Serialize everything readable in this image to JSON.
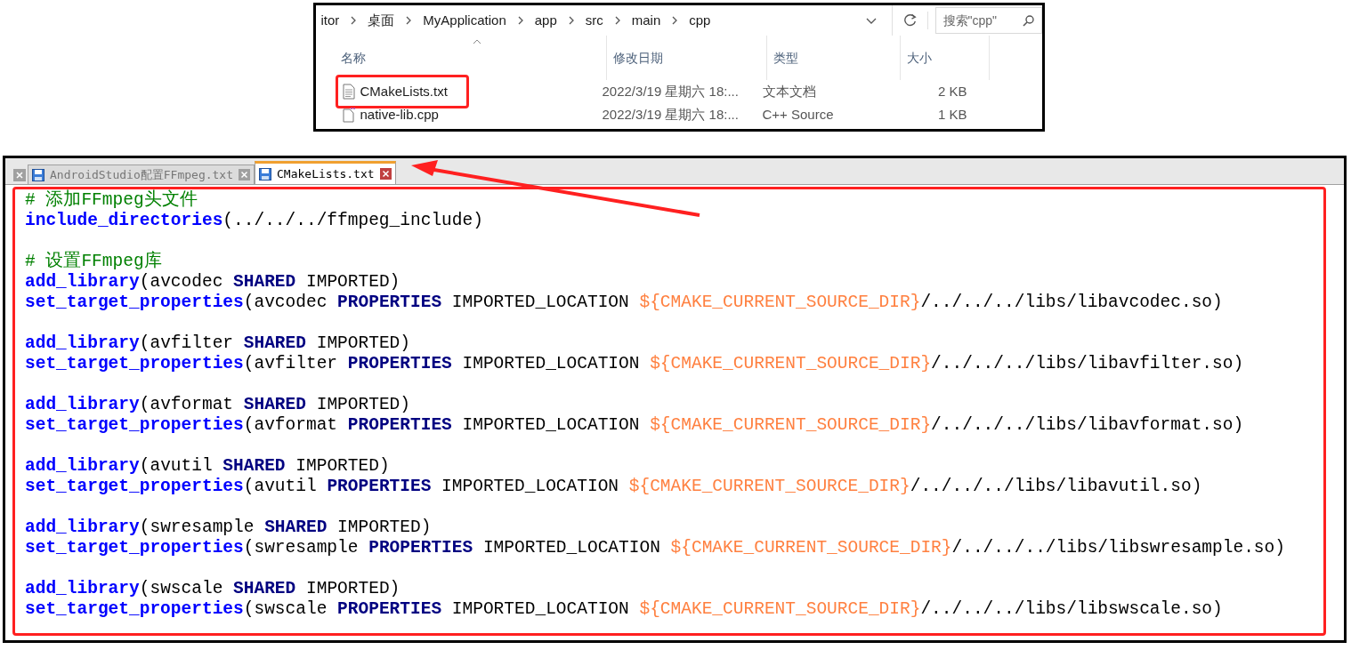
{
  "explorer": {
    "breadcrumb": [
      "itor",
      "桌面",
      "MyApplication",
      "app",
      "src",
      "main",
      "cpp"
    ],
    "search": {
      "placeholder": "搜索\"cpp\""
    },
    "columns": [
      "名称",
      "修改日期",
      "类型",
      "大小"
    ],
    "files": [
      {
        "kind": "text",
        "name": "CMakeLists.txt",
        "modified": "2022/3/19 星期六 18:...",
        "type": "文本文档",
        "size": "2 KB",
        "highlighted": true
      },
      {
        "kind": "source",
        "name": "native-lib.cpp",
        "modified": "2022/3/19 星期六 18:...",
        "type": "C++ Source",
        "size": "1 KB",
        "highlighted": false
      }
    ]
  },
  "editor": {
    "tabs": [
      {
        "label": "AndroidStudio配置FFmpeg.txt",
        "selected": false
      },
      {
        "label": "CMakeLists.txt",
        "selected": true
      }
    ],
    "lines": [
      {
        "tokens": [
          {
            "kind": "comment",
            "text": "# 添加FFmpeg头文件"
          }
        ]
      },
      {
        "tokens": [
          {
            "kind": "func",
            "text": "include_directories"
          },
          {
            "kind": "plain",
            "text": "(../../../ffmpeg_include)"
          }
        ]
      },
      {
        "kind": "blank"
      },
      {
        "tokens": [
          {
            "kind": "comment",
            "text": "# 设置FFmpeg库"
          }
        ]
      },
      {
        "tokens": [
          {
            "kind": "func",
            "text": "add_library"
          },
          {
            "kind": "plain",
            "text": "(avcodec "
          },
          {
            "kind": "keyword",
            "text": "SHARED"
          },
          {
            "kind": "plain",
            "text": " IMPORTED)"
          }
        ]
      },
      {
        "tokens": [
          {
            "kind": "func",
            "text": "set_target_properties"
          },
          {
            "kind": "plain",
            "text": "(avcodec "
          },
          {
            "kind": "keyword",
            "text": "PROPERTIES"
          },
          {
            "kind": "plain",
            "text": " IMPORTED_LOCATION "
          },
          {
            "kind": "var",
            "text": "${CMAKE_CURRENT_SOURCE_DIR}"
          },
          {
            "kind": "plain",
            "text": "/../../../libs/libavcodec.so)"
          }
        ]
      },
      {
        "kind": "blank"
      },
      {
        "tokens": [
          {
            "kind": "func",
            "text": "add_library"
          },
          {
            "kind": "plain",
            "text": "(avfilter "
          },
          {
            "kind": "keyword",
            "text": "SHARED"
          },
          {
            "kind": "plain",
            "text": " IMPORTED)"
          }
        ]
      },
      {
        "tokens": [
          {
            "kind": "func",
            "text": "set_target_properties"
          },
          {
            "kind": "plain",
            "text": "(avfilter "
          },
          {
            "kind": "keyword",
            "text": "PROPERTIES"
          },
          {
            "kind": "plain",
            "text": " IMPORTED_LOCATION "
          },
          {
            "kind": "var",
            "text": "${CMAKE_CURRENT_SOURCE_DIR}"
          },
          {
            "kind": "plain",
            "text": "/../../../libs/libavfilter.so)"
          }
        ]
      },
      {
        "kind": "blank"
      },
      {
        "tokens": [
          {
            "kind": "func",
            "text": "add_library"
          },
          {
            "kind": "plain",
            "text": "(avformat "
          },
          {
            "kind": "keyword",
            "text": "SHARED"
          },
          {
            "kind": "plain",
            "text": " IMPORTED)"
          }
        ]
      },
      {
        "tokens": [
          {
            "kind": "func",
            "text": "set_target_properties"
          },
          {
            "kind": "plain",
            "text": "(avformat "
          },
          {
            "kind": "keyword",
            "text": "PROPERTIES"
          },
          {
            "kind": "plain",
            "text": " IMPORTED_LOCATION "
          },
          {
            "kind": "var",
            "text": "${CMAKE_CURRENT_SOURCE_DIR}"
          },
          {
            "kind": "plain",
            "text": "/../../../libs/libavformat.so)"
          }
        ]
      },
      {
        "kind": "blank"
      },
      {
        "tokens": [
          {
            "kind": "func",
            "text": "add_library"
          },
          {
            "kind": "plain",
            "text": "(avutil "
          },
          {
            "kind": "keyword",
            "text": "SHARED"
          },
          {
            "kind": "plain",
            "text": " IMPORTED)"
          }
        ]
      },
      {
        "tokens": [
          {
            "kind": "func",
            "text": "set_target_properties"
          },
          {
            "kind": "plain",
            "text": "(avutil "
          },
          {
            "kind": "keyword",
            "text": "PROPERTIES"
          },
          {
            "kind": "plain",
            "text": " IMPORTED_LOCATION "
          },
          {
            "kind": "var",
            "text": "${CMAKE_CURRENT_SOURCE_DIR}"
          },
          {
            "kind": "plain",
            "text": "/../../../libs/libavutil.so)"
          }
        ]
      },
      {
        "kind": "blank"
      },
      {
        "tokens": [
          {
            "kind": "func",
            "text": "add_library"
          },
          {
            "kind": "plain",
            "text": "(swresample "
          },
          {
            "kind": "keyword",
            "text": "SHARED"
          },
          {
            "kind": "plain",
            "text": " IMPORTED)"
          }
        ]
      },
      {
        "tokens": [
          {
            "kind": "func",
            "text": "set_target_properties"
          },
          {
            "kind": "plain",
            "text": "(swresample "
          },
          {
            "kind": "keyword",
            "text": "PROPERTIES"
          },
          {
            "kind": "plain",
            "text": " IMPORTED_LOCATION "
          },
          {
            "kind": "var",
            "text": "${CMAKE_CURRENT_SOURCE_DIR}"
          },
          {
            "kind": "plain",
            "text": "/../../../libs/libswresample.so)"
          }
        ]
      },
      {
        "kind": "blank"
      },
      {
        "tokens": [
          {
            "kind": "func",
            "text": "add_library"
          },
          {
            "kind": "plain",
            "text": "(swscale "
          },
          {
            "kind": "keyword",
            "text": "SHARED"
          },
          {
            "kind": "plain",
            "text": " IMPORTED)"
          }
        ]
      },
      {
        "tokens": [
          {
            "kind": "func",
            "text": "set_target_properties"
          },
          {
            "kind": "plain",
            "text": "(swscale "
          },
          {
            "kind": "keyword",
            "text": "PROPERTIES"
          },
          {
            "kind": "plain",
            "text": " IMPORTED_LOCATION "
          },
          {
            "kind": "var",
            "text": "${CMAKE_CURRENT_SOURCE_DIR}"
          },
          {
            "kind": "plain",
            "text": "/../../../libs/libswscale.so)"
          }
        ]
      }
    ]
  }
}
